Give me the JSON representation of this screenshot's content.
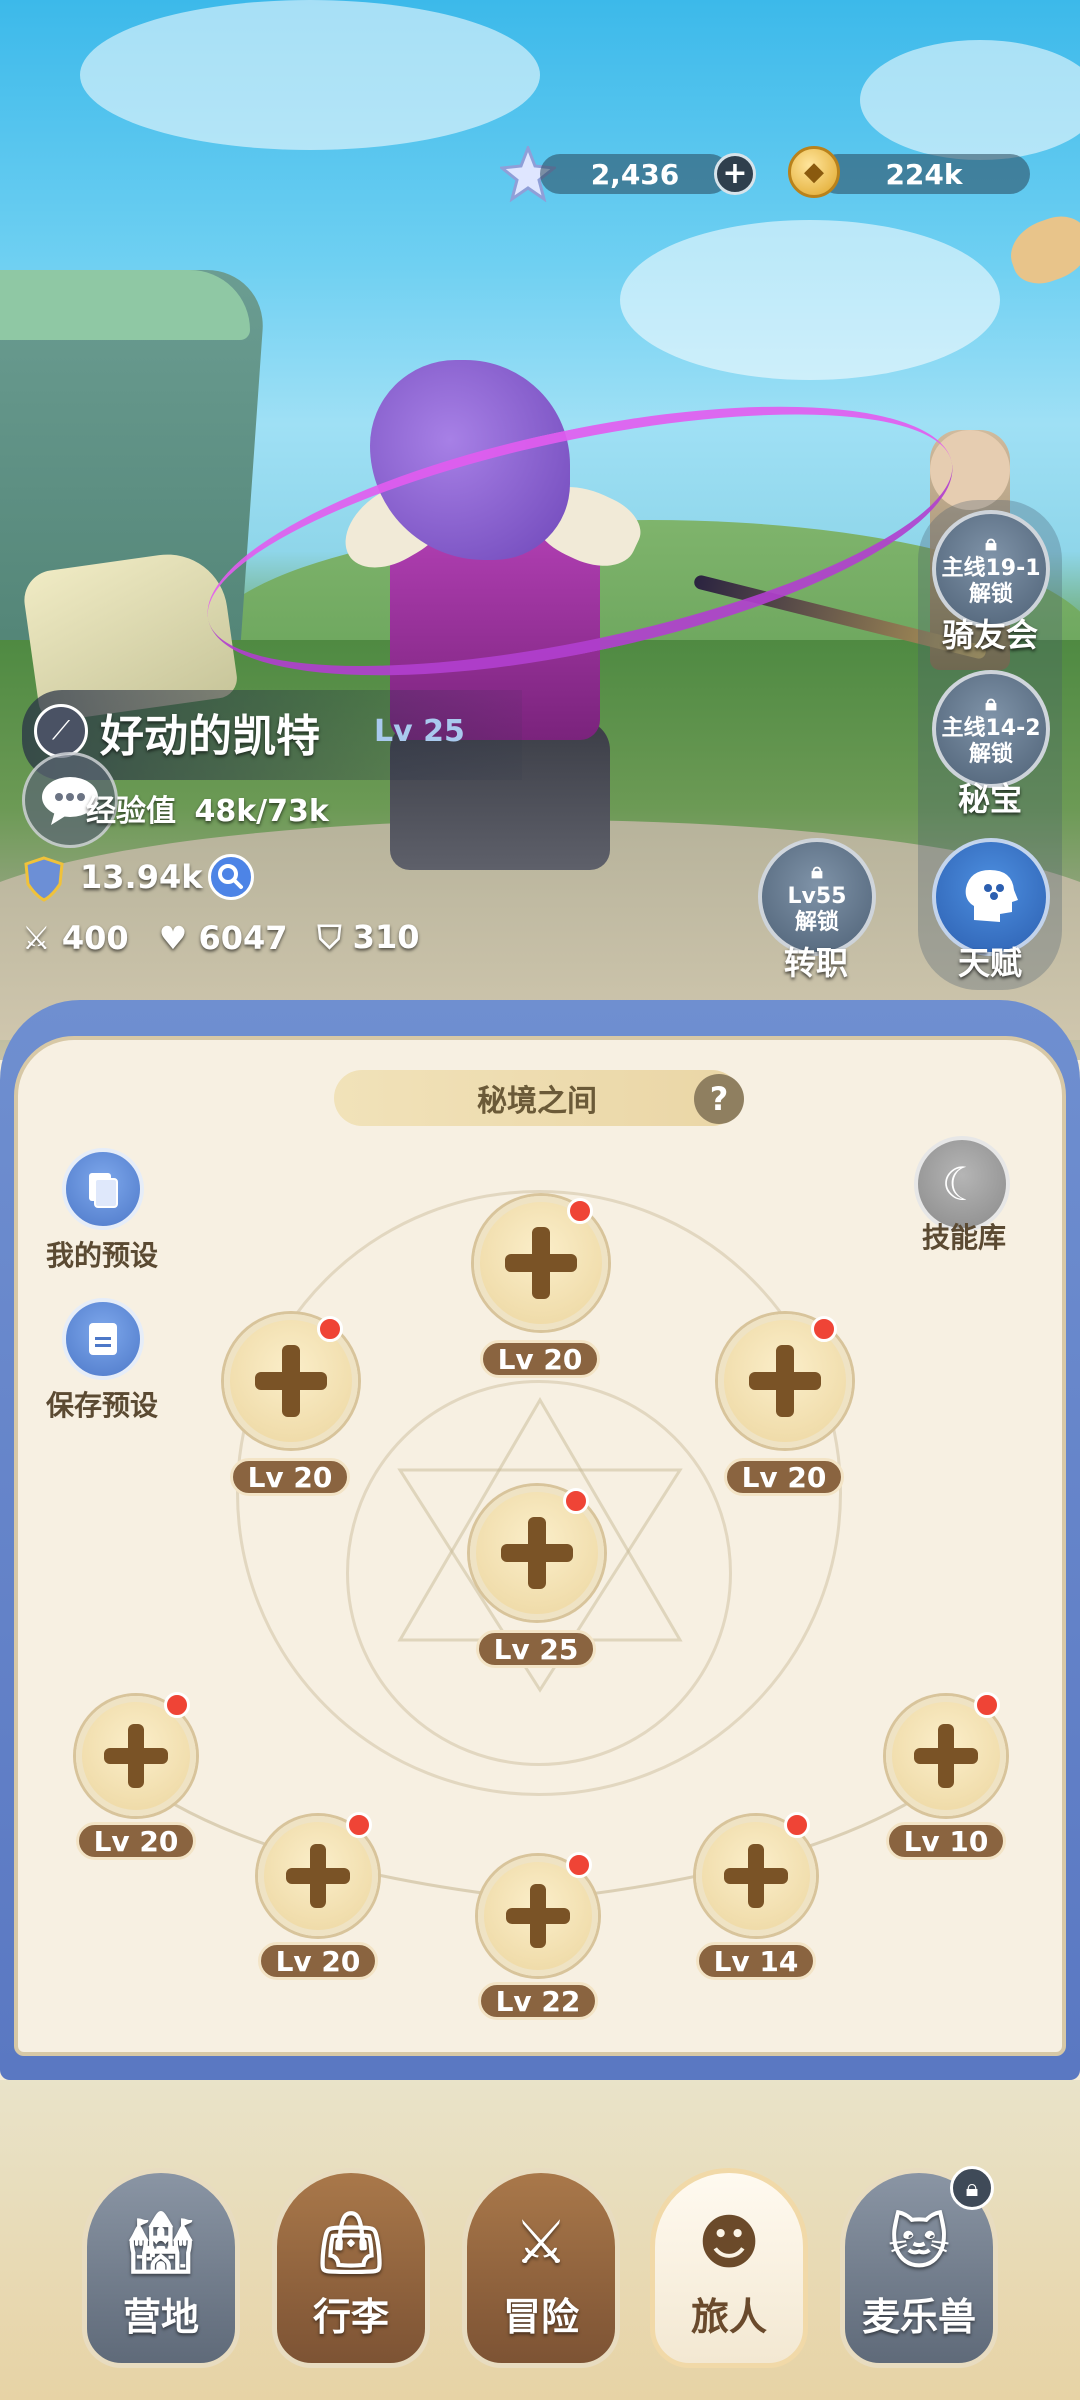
{
  "currency": {
    "gems": "2,436",
    "gold": "224k"
  },
  "player": {
    "name": "好动的凯特",
    "level": "Lv 25",
    "exp_label": "经验值",
    "exp_value": "48k/73k",
    "power": "13.94k",
    "attack": "400",
    "hp": "6047",
    "defense": "310"
  },
  "side_buttons": [
    {
      "lock_line1": "主线19-1",
      "lock_line2": "解锁",
      "label": "骑友会"
    },
    {
      "lock_line1": "主线14-2",
      "lock_line2": "解锁",
      "label": "秘宝"
    },
    {
      "lock_line1": "Lv55",
      "lock_line2": "解锁",
      "label": "转职"
    },
    {
      "label": "天赋"
    }
  ],
  "panel": {
    "title": "秘境之间",
    "help": "?",
    "my_presets": "我的预设",
    "save_preset": "保存预设",
    "skill_library": "技能库"
  },
  "slots": [
    {
      "level": "Lv 20"
    },
    {
      "level": "Lv 20"
    },
    {
      "level": "Lv 20"
    },
    {
      "level": "Lv 25"
    },
    {
      "level": "Lv 20"
    },
    {
      "level": "Lv 20"
    },
    {
      "level": "Lv 22"
    },
    {
      "level": "Lv 14"
    },
    {
      "level": "Lv 10"
    }
  ],
  "nav": [
    {
      "label": "营地",
      "icon": "castle-icon"
    },
    {
      "label": "行李",
      "icon": "bag-icon"
    },
    {
      "label": "冒险",
      "icon": "crossed-swords-icon"
    },
    {
      "label": "旅人",
      "icon": "traveler-icon",
      "active": true
    },
    {
      "label": "麦乐兽",
      "icon": "cat-icon",
      "locked": true
    }
  ],
  "colors": {
    "accent_blue": "#5a78c2",
    "badge_red": "#ef4436",
    "slot_brown": "#8a6440"
  }
}
